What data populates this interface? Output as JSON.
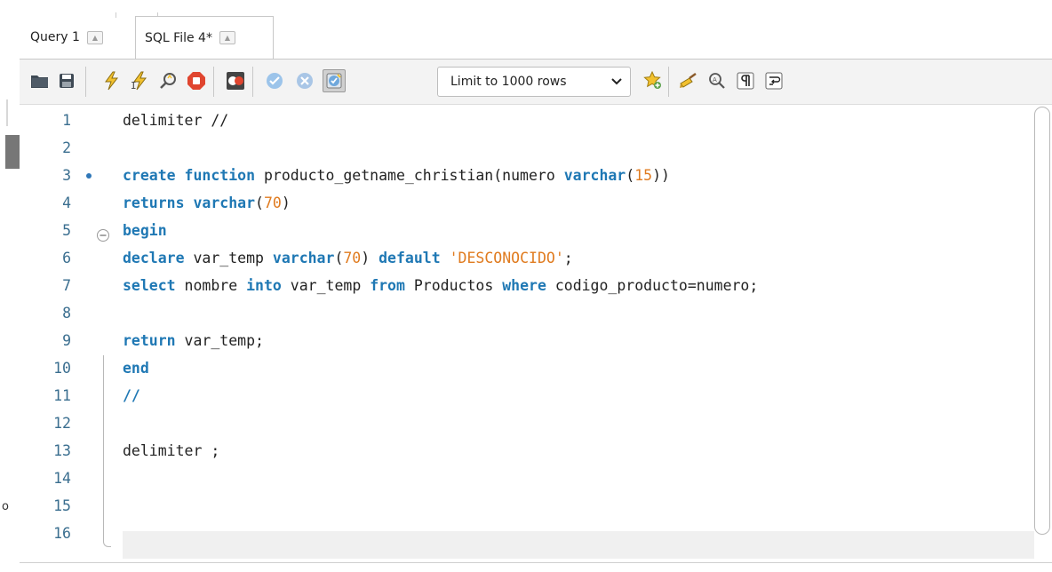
{
  "tabs": [
    {
      "label": "Query 1",
      "active": false
    },
    {
      "label": "SQL File 4*",
      "active": true
    }
  ],
  "toolbar": {
    "limit_select": "Limit to 1000 rows",
    "icons": [
      "open-folder-icon",
      "save-icon",
      "execute-icon",
      "execute-current-icon",
      "explain-icon",
      "stop-icon",
      "error-toggle-icon",
      "commit-icon",
      "rollback-icon",
      "autocommit-icon",
      "favorites-icon",
      "beautify-icon",
      "find-icon",
      "invisible-chars-icon",
      "wrap-icon"
    ]
  },
  "editor": {
    "lines": [
      {
        "n": "1",
        "t": [
          {
            "c": "delimiter //"
          }
        ]
      },
      {
        "n": "2",
        "t": []
      },
      {
        "n": "3",
        "dot": true,
        "t": [
          {
            "c": "create function",
            "k": "kw"
          },
          {
            "c": " producto_getname_christian(numero "
          },
          {
            "c": "varchar",
            "k": "kw"
          },
          {
            "c": "("
          },
          {
            "c": "15",
            "k": "num"
          },
          {
            "c": "))"
          }
        ]
      },
      {
        "n": "4",
        "t": [
          {
            "c": "returns varchar",
            "k": "kw"
          },
          {
            "c": "("
          },
          {
            "c": "70",
            "k": "num"
          },
          {
            "c": ")"
          }
        ]
      },
      {
        "n": "5",
        "fold": true,
        "t": [
          {
            "c": "begin",
            "k": "kw"
          }
        ]
      },
      {
        "n": "6",
        "t": [
          {
            "c": "declare",
            "k": "kw"
          },
          {
            "c": " var_temp "
          },
          {
            "c": "varchar",
            "k": "kw"
          },
          {
            "c": "("
          },
          {
            "c": "70",
            "k": "num"
          },
          {
            "c": ") "
          },
          {
            "c": "default",
            "k": "kw"
          },
          {
            "c": " "
          },
          {
            "c": "'DESCONOCIDO'",
            "k": "str"
          },
          {
            "c": ";"
          }
        ]
      },
      {
        "n": "7",
        "t": [
          {
            "c": "select",
            "k": "kw"
          },
          {
            "c": " nombre "
          },
          {
            "c": "into",
            "k": "kw"
          },
          {
            "c": " var_temp "
          },
          {
            "c": "from",
            "k": "kw"
          },
          {
            "c": " Productos "
          },
          {
            "c": "where",
            "k": "kw"
          },
          {
            "c": " codigo_producto=numero;"
          }
        ]
      },
      {
        "n": "8",
        "t": []
      },
      {
        "n": "9",
        "t": [
          {
            "c": "return",
            "k": "kw"
          },
          {
            "c": " var_temp;"
          }
        ]
      },
      {
        "n": "10",
        "t": [
          {
            "c": "end",
            "k": "kw"
          }
        ]
      },
      {
        "n": "11",
        "t": [
          {
            "c": "//",
            "k": "kw"
          }
        ]
      },
      {
        "n": "12",
        "t": []
      },
      {
        "n": "13",
        "t": [
          {
            "c": "delimiter ;"
          }
        ]
      },
      {
        "n": "14",
        "t": []
      },
      {
        "n": "15",
        "t": []
      },
      {
        "n": "16",
        "t": []
      }
    ]
  },
  "left_stub": "o"
}
